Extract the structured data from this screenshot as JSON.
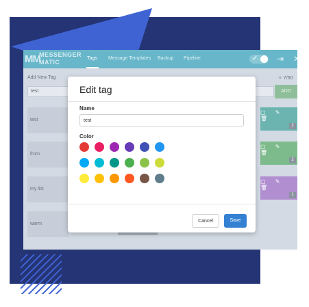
{
  "app": {
    "logo_mark": "MM",
    "logo_line1": "MESSENGER",
    "logo_line2": "MATIC",
    "nav": [
      "Tags",
      "Message Templates",
      "Backup",
      "Pipeline"
    ],
    "active_nav": "Tags"
  },
  "toolbar": {
    "check_icon": "✓",
    "export_icon": "⇥",
    "close_icon": "✕"
  },
  "page": {
    "add_label": "Add New Tag",
    "add_value": "test",
    "add_button": "ADD",
    "count": "✧ 7/50",
    "tags": [
      "test",
      "from",
      "my list",
      "warm"
    ],
    "tag_counts": [
      "2",
      "2",
      "1"
    ],
    "tag_card_icons": "▢ ✎ 🗑"
  },
  "modal": {
    "title": "Edit tag",
    "name_label": "Name",
    "name_value": "test",
    "color_label": "Color",
    "cancel_label": "Cancel",
    "save_label": "Save"
  },
  "colors": {
    "swatches": [
      [
        "#e53935",
        "#e91e63",
        "#9c27b0",
        "#673ab7",
        "#3f51b5",
        "#2196f3"
      ],
      [
        "#03a9f4",
        "#00bcd4",
        "#009688",
        "#4caf50",
        "#8bc34a",
        "#cddc39"
      ],
      [
        "#ffeb3b",
        "#ffc107",
        "#ff9800",
        "#ff5722",
        "#795548",
        "#607d8b"
      ]
    ],
    "navy_bg": "#243474",
    "accent_blue": "#3f63d3",
    "save_button": "#3480d2",
    "card_teal": "#6bb4b0",
    "card_green": "#7dbb8c",
    "card_purple": "#b18ed0"
  }
}
